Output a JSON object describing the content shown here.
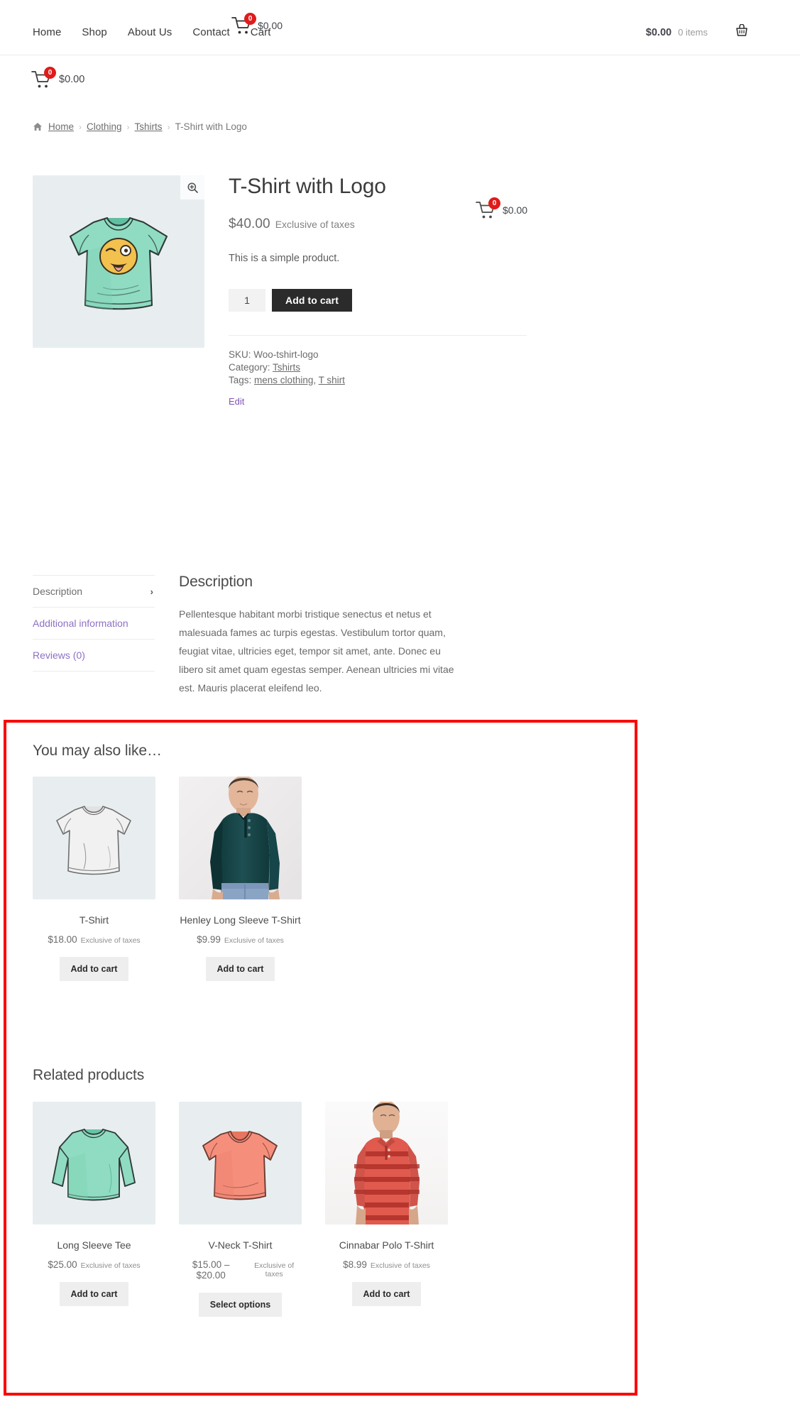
{
  "header": {
    "nav": [
      {
        "label": "Home"
      },
      {
        "label": "Shop"
      },
      {
        "label": "About Us"
      },
      {
        "label": "Contact"
      },
      {
        "label": "Cart"
      }
    ],
    "minicart": {
      "count": "0",
      "amount": "$0.00",
      "icon": "shopping-cart-icon"
    },
    "right": {
      "total": "$0.00",
      "items": "0 items",
      "icon": "basket-icon"
    }
  },
  "subcart": {
    "count": "0",
    "amount": "$0.00",
    "icon": "shopping-cart-icon"
  },
  "float_cart": {
    "count": "0",
    "amount": "$0.00",
    "icon": "shopping-cart-icon"
  },
  "breadcrumb": {
    "home_icon": "home-icon",
    "items": [
      {
        "label": "Home",
        "link": true
      },
      {
        "label": "Clothing",
        "link": true
      },
      {
        "label": "Tshirts",
        "link": true
      },
      {
        "label": "T-Shirt with Logo",
        "link": false
      }
    ],
    "separator": "›"
  },
  "product": {
    "title": "T-Shirt with Logo",
    "price": "$40.00",
    "tax_note": "Exclusive of taxes",
    "short_description": "This is a simple product.",
    "quantity": "1",
    "add_to_cart_label": "Add to cart",
    "zoom_icon": "magnifier-plus-icon",
    "image_alt": "mint-green-v-neck-tshirt-with-winking-emoji-logo",
    "meta": {
      "sku_label": "SKU:",
      "sku_value": "Woo-tshirt-logo",
      "category_label": "Category:",
      "category_value": "Tshirts",
      "tags_label": "Tags:",
      "tags": [
        "mens clothing",
        "T shirt"
      ],
      "tags_separator": ", "
    },
    "edit_label": "Edit"
  },
  "tabs": {
    "items": [
      {
        "label": "Description",
        "active": true,
        "chevron": "›"
      },
      {
        "label": "Additional information",
        "active": false
      },
      {
        "label": "Reviews (0)",
        "active": false
      }
    ],
    "panel": {
      "title": "Description",
      "body": "Pellentesque habitant morbi tristique senectus et netus et malesuada fames ac turpis egestas. Vestibulum tortor quam, feugiat vitae, ultricies eget, tempor sit amet, ante. Donec eu libero sit amet quam egestas semper. Aenean ultricies mi vitae est. Mauris placerat eleifend leo."
    }
  },
  "upsells": {
    "heading": "You may also like…",
    "products": [
      {
        "title": "T-Shirt",
        "price": "$18.00",
        "tax_note": "Exclusive of taxes",
        "button": "Add to cart",
        "image_alt": "white-short-sleeve-tshirt-illustration",
        "image_kind": "illustration-white-tee"
      },
      {
        "title": "Henley Long Sleeve T-Shirt",
        "price": "$9.99",
        "tax_note": "Exclusive of taxes",
        "button": "Add to cart",
        "image_alt": "man-wearing-dark-teal-henley-long-sleeve-shirt",
        "image_kind": "photo-henley"
      }
    ]
  },
  "related": {
    "heading": "Related products",
    "products": [
      {
        "title": "Long Sleeve Tee",
        "price": "$25.00",
        "tax_note": "Exclusive of taxes",
        "button": "Add to cart",
        "image_alt": "mint-green-long-sleeve-tee-illustration",
        "image_kind": "illustration-long-sleeve"
      },
      {
        "title": "V-Neck T-Shirt",
        "price": "$15.00 – $20.00",
        "tax_note": "Exclusive of taxes",
        "button": "Select options",
        "image_alt": "coral-v-neck-tshirt-illustration",
        "image_kind": "illustration-vneck"
      },
      {
        "title": "Cinnabar Polo T-Shirt",
        "price": "$8.99",
        "tax_note": "Exclusive of taxes",
        "button": "Add to cart",
        "image_alt": "man-wearing-red-striped-polo-shirt",
        "image_kind": "photo-polo"
      }
    ]
  },
  "highlight": {
    "color": "#fb0500",
    "label": "upsells-and-related-products-highlight"
  },
  "colors": {
    "accent_purple": "#7f54b3",
    "badge_red": "#e01b1b",
    "button_dark": "#2b2b2b",
    "thumb_bg": "#e8eef0",
    "highlight_red": "#fb0500"
  }
}
